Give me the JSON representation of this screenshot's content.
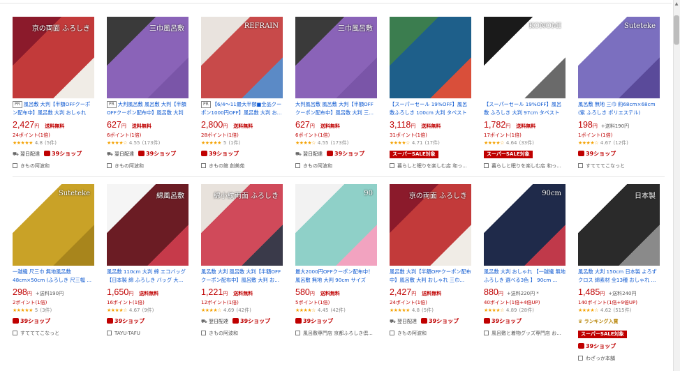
{
  "common": {
    "shipping_free": "送料無料",
    "next_day": "翌日配達",
    "shop39": "39ショップ",
    "yen": "円",
    "pr": "PR",
    "sale_badge": "スーパーSALE対象",
    "ranking": "ランキング入賞"
  },
  "row1": [
    {
      "name": "風呂敷 大判【半額OFFクーポン配布中】風呂敷 大判 おしゃれ",
      "pr": true,
      "price": "2,427",
      "ship_text": "送料無料",
      "points": "24ポイント(1倍)",
      "stars": "★★★★★",
      "rating": "4.8",
      "reviews": "(5件)",
      "next_day": true,
      "shop39": true,
      "sale": false,
      "shop": "きもの阿波和",
      "colors": [
        "#8b1a2b",
        "#c23a3a",
        "#f0ece6"
      ],
      "img_text": "京の両面 ふろしき"
    },
    {
      "name": "大判風呂敷 風呂敷 大判【半額OFFクーポン配布中】風呂敷 大判 お",
      "pr": true,
      "price": "627",
      "ship_text": "送料無料",
      "points": "6ポイント(1倍)",
      "stars": "★★★★☆",
      "rating": "4.55",
      "reviews": "(173件)",
      "next_day": true,
      "shop39": true,
      "sale": false,
      "shop": "きもの阿波和",
      "colors": [
        "#3a3a3a",
        "#8a63b8",
        "#7a55a8"
      ],
      "img_text": "三巾風呂敷"
    },
    {
      "name": "【6/4～11最大半額■全品クーポン1000円OFF】風呂敷 大判 お...",
      "pr": true,
      "price": "2,800",
      "ship_text": "送料無料",
      "points": "28ポイント(1倍)",
      "stars": "★★★★★",
      "rating": "5",
      "reviews": "(1件)",
      "next_day": false,
      "shop39": true,
      "sale": false,
      "shop": "きもの館 創美苑",
      "colors": [
        "#e9e3de",
        "#c84a4a",
        "#5b8ac6"
      ],
      "img_text": "REFRAIN"
    },
    {
      "name": "大判風呂敷 風呂敷 大判【半額OFFクーポン配布中】風呂敷 大判 三...",
      "pr": false,
      "price": "627",
      "ship_text": "送料無料",
      "points": "6ポイント(1倍)",
      "stars": "★★★★☆",
      "rating": "4.55",
      "reviews": "(173件)",
      "next_day": true,
      "shop39": true,
      "sale": false,
      "shop": "きもの阿波和",
      "colors": [
        "#3a3a3a",
        "#8a63b8",
        "#7a55a8"
      ],
      "img_text": "三巾風呂敷"
    },
    {
      "name": "【スーパーセール 19%OFF】風呂敷ふろしき 100cm 大判 タペストリ...",
      "pr": false,
      "price": "3,118",
      "ship_text": "送料無料",
      "points": "31ポイント(1倍)",
      "stars": "★★★★☆",
      "rating": "4.71",
      "reviews": "(17件)",
      "next_day": false,
      "shop39": false,
      "sale": true,
      "shop": "暮らしと眠りを楽しむ店 和っ...",
      "colors": [
        "#3b7d4f",
        "#1e5f8a",
        "#d94f3a"
      ],
      "img_text": ""
    },
    {
      "name": "【スーパーセール 19%OFF】風呂敷 ふろしき 大判 97cm タペストリ...",
      "pr": false,
      "price": "1,782",
      "ship_text": "送料無料",
      "points": "17ポイント(1倍)",
      "stars": "★★★★☆",
      "rating": "4.64",
      "reviews": "(33件)",
      "next_day": false,
      "shop39": false,
      "sale": true,
      "shop": "暮らしと眠りを楽しむ店 和っ...",
      "colors": [
        "#1a1a1a",
        "#ffffff",
        "#6a6a6a"
      ],
      "img_text": "KONOMI"
    },
    {
      "name": "風呂敷 無地 三巾 約68cm×68cm (紫 ふろしき ポリエステル)",
      "pr": false,
      "price": "198",
      "ship_text": "+送料190円",
      "points": "1ポイント(1倍)",
      "stars": "★★★★☆",
      "rating": "4.67",
      "reviews": "(12件)",
      "next_day": false,
      "shop39": true,
      "sale": false,
      "shop": "すてててこなっと",
      "colors": [
        "#ffffff",
        "#7b6fbf",
        "#5a4a9a"
      ],
      "img_text": "Suteteke"
    }
  ],
  "row2": [
    {
      "name": "一越織 尺三巾 無地風呂敷 48cm×50cm (ふろしき 尺三幅 ...",
      "pr": false,
      "price": "298",
      "ship_text": "+送料190円",
      "points": "2ポイント(1倍)",
      "stars": "★★★★★",
      "rating": "5",
      "reviews": "(3件)",
      "next_day": false,
      "shop39": true,
      "sale": false,
      "ranking": false,
      "shop": "すてててこなっと",
      "colors": [
        "#ffffff",
        "#c9a227",
        "#a8851c"
      ],
      "img_text": "Suteteke"
    },
    {
      "name": "風呂敷 110cm 大判 綿 エコバッグ【日本製 綿 ふろしき バッグ 大...",
      "pr": false,
      "price": "1,650",
      "ship_text": "送料無料",
      "points": "16ポイント(1倍)",
      "stars": "★★★★☆",
      "rating": "4.67",
      "reviews": "(9件)",
      "next_day": false,
      "shop39": true,
      "sale": false,
      "ranking": false,
      "shop": "TAYU-TAFU",
      "colors": [
        "#f5f5f5",
        "#6b1c24",
        "#c63a4a"
      ],
      "img_text": "綿風呂敷"
    },
    {
      "name": "風呂敷 大判 風呂敷 大判【半額OFFクーポン配布中】風呂敷 大判 お...",
      "pr": false,
      "price": "1,221",
      "ship_text": "送料無料",
      "points": "12ポイント(1倍)",
      "stars": "★★★★☆",
      "rating": "4.69",
      "reviews": "(42件)",
      "next_day": true,
      "shop39": true,
      "sale": false,
      "ranking": false,
      "shop": "きもの阿波和",
      "colors": [
        "#e8e2dc",
        "#d04a5a",
        "#3a3a4a"
      ],
      "img_text": "綿小紋両面 ふろしき"
    },
    {
      "name": "最大2000円OFFクーポン配布中！風呂敷 無地 大判 90cm サイズ 二...",
      "pr": false,
      "price": "580",
      "ship_text": "送料無料",
      "points": "5ポイント(1倍)",
      "stars": "★★★★☆",
      "rating": "4.45",
      "reviews": "(42件)",
      "next_day": false,
      "shop39": true,
      "sale": false,
      "ranking": false,
      "shop": "風呂敷専門店 京都ふろしき倶...",
      "colors": [
        "#f2f2f2",
        "#8fd0c8",
        "#f2a3c0"
      ],
      "img_text": "90"
    },
    {
      "name": "風呂敷 大判【半額OFFクーポン配布中】風呂敷 大判 おしゃれ 三巾...",
      "pr": false,
      "price": "2,427",
      "ship_text": "送料無料",
      "points": "24ポイント(1倍)",
      "stars": "★★★★★",
      "rating": "4.8",
      "reviews": "(5件)",
      "next_day": true,
      "shop39": true,
      "sale": false,
      "ranking": false,
      "shop": "きもの阿波和",
      "colors": [
        "#8b1a2b",
        "#c23a3a",
        "#f0ece6"
      ],
      "img_text": "京の両面 ふろしき"
    },
    {
      "name": "風呂敷 大判 おしゃれ 【一越織 無地ふろしき 選べる3色 】 90cm ...",
      "pr": false,
      "price": "880",
      "ship_text": "+送料220円 *",
      "points": "40ポイント(1倍+4倍UP)",
      "stars": "★★★★☆",
      "rating": "4.89",
      "reviews": "(28件)",
      "next_day": false,
      "shop39": true,
      "sale": false,
      "ranking": false,
      "shop": "風呂敷と着物グッズ専門店 お...",
      "colors": [
        "#ffffff",
        "#1f2a4a",
        "#c0394a"
      ],
      "img_text": "90cm"
    },
    {
      "name": "風呂敷 大判 150cm 日本製 よろずクロス 綿素材 全13種 おしゃれ ...",
      "pr": false,
      "price": "1,485",
      "ship_text": "+送料240円",
      "points": "140ポイント(1倍+9倍UP)",
      "stars": "★★★★☆",
      "rating": "4.62",
      "reviews": "(515件)",
      "next_day": false,
      "shop39": true,
      "sale": true,
      "ranking": true,
      "shop": "わざっか本舗",
      "colors": [
        "#ffffff",
        "#2a2a2a",
        "#8a8a8a"
      ],
      "img_text": "日本製"
    }
  ]
}
